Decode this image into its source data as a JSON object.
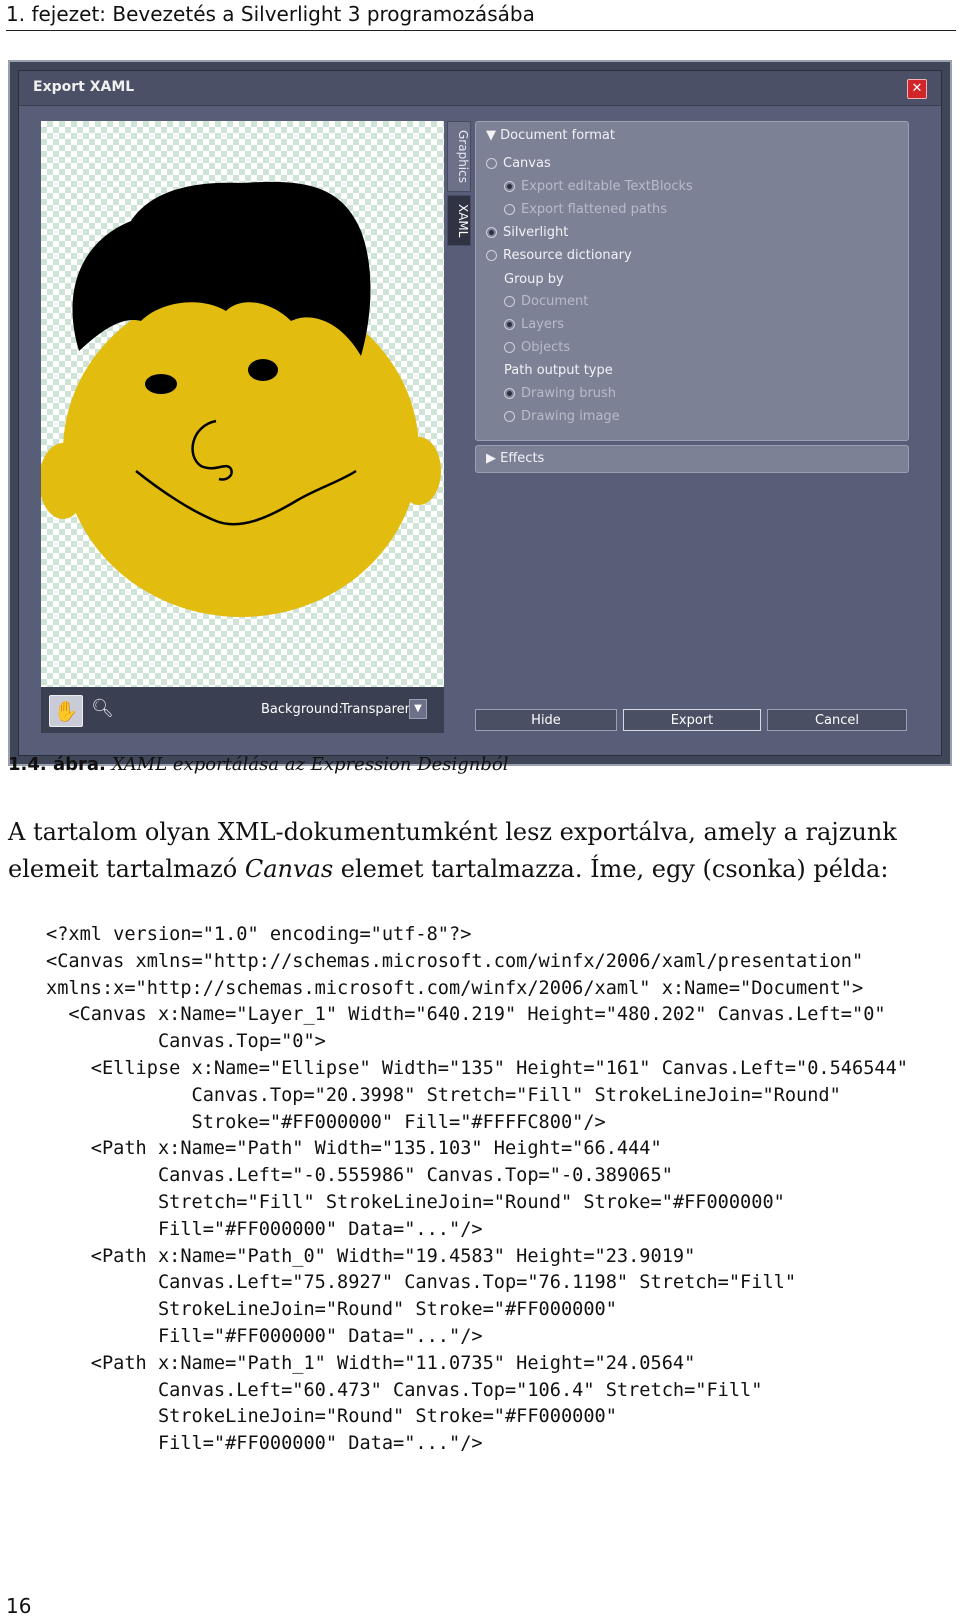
{
  "header": {
    "running_title": "1. fejezet: Bevezetés a Silverlight 3 programozásába"
  },
  "dialog": {
    "title": "Export XAML",
    "close_label": "✕",
    "tabs": [
      "Graphics",
      "XAML"
    ],
    "active_tab": "XAML",
    "document_format": {
      "heading": "▼ Document format",
      "canvas": "Canvas",
      "export_editable_textblocks": "Export editable TextBlocks",
      "export_flattened_paths": "Export flattened paths",
      "silverlight": "Silverlight",
      "resource_dictionary": "Resource dictionary",
      "group_by": "Group by",
      "group_document": "Document",
      "group_layers": "Layers",
      "group_objects": "Objects",
      "path_output_type": "Path output type",
      "drawing_brush": "Drawing brush",
      "drawing_image": "Drawing image"
    },
    "effects": "▶ Effects",
    "background_label": "Background:",
    "background_value": "Transparent",
    "buttons": {
      "hide": "Hide",
      "export": "Export",
      "cancel": "Cancel"
    },
    "colors": {
      "face": "#E3BC10",
      "hair": "#000000",
      "dialog": "#585E78",
      "close": "#D0262A"
    }
  },
  "caption": {
    "number": "1.4. ábra.",
    "text": "XAML exportálása az Expression Designból"
  },
  "paragraph": {
    "line1": "A tartalom olyan XML-dokumentumként lesz exportálva, amely a rajzunk",
    "line2_a": "elemeit tartalmazó ",
    "line2_italic": "Canvas",
    "line2_b": " elemet tartalmazza. Íme, egy (csonka) példa:"
  },
  "code_lines": [
    "<?xml version=\"1.0\" encoding=\"utf-8\"?>",
    "<Canvas xmlns=\"http://schemas.microsoft.com/winfx/2006/xaml/presentation\"",
    "xmlns:x=\"http://schemas.microsoft.com/winfx/2006/xaml\" x:Name=\"Document\">",
    "  <Canvas x:Name=\"Layer_1\" Width=\"640.219\" Height=\"480.202\" Canvas.Left=\"0\"",
    "          Canvas.Top=\"0\">",
    "    <Ellipse x:Name=\"Ellipse\" Width=\"135\" Height=\"161\" Canvas.Left=\"0.546544\"",
    "             Canvas.Top=\"20.3998\" Stretch=\"Fill\" StrokeLineJoin=\"Round\"",
    "             Stroke=\"#FF000000\" Fill=\"#FFFFC800\"/>",
    "    <Path x:Name=\"Path\" Width=\"135.103\" Height=\"66.444\"",
    "          Canvas.Left=\"-0.555986\" Canvas.Top=\"-0.389065\"",
    "          Stretch=\"Fill\" StrokeLineJoin=\"Round\" Stroke=\"#FF000000\"",
    "          Fill=\"#FF000000\" Data=\"...\"/>",
    "    <Path x:Name=\"Path_0\" Width=\"19.4583\" Height=\"23.9019\"",
    "          Canvas.Left=\"75.8927\" Canvas.Top=\"76.1198\" Stretch=\"Fill\"",
    "          StrokeLineJoin=\"Round\" Stroke=\"#FF000000\"",
    "          Fill=\"#FF000000\" Data=\"...\"/>",
    "    <Path x:Name=\"Path_1\" Width=\"11.0735\" Height=\"24.0564\"",
    "          Canvas.Left=\"60.473\" Canvas.Top=\"106.4\" Stretch=\"Fill\"",
    "          StrokeLineJoin=\"Round\" Stroke=\"#FF000000\"",
    "          Fill=\"#FF000000\" Data=\"...\"/>"
  ],
  "page_number": "16"
}
